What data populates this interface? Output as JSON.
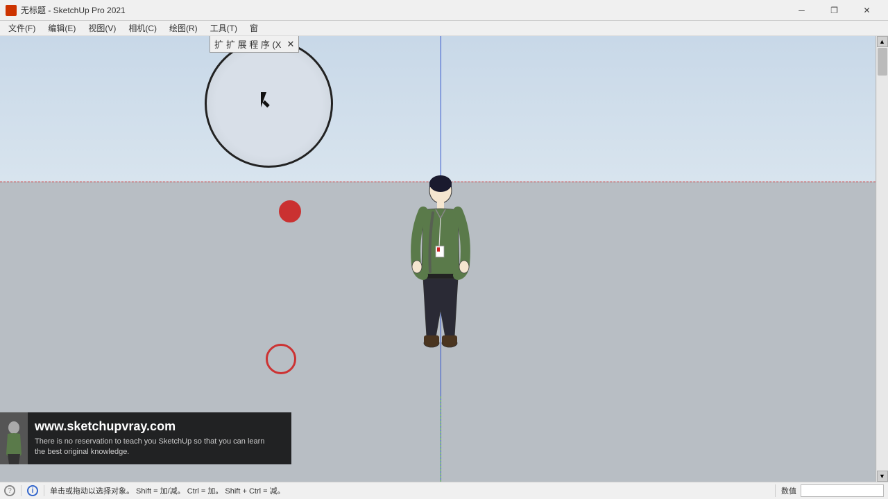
{
  "titlebar": {
    "title": "无标题 - SketchUp Pro 2021",
    "minimize": "─",
    "restore": "❐",
    "close": "✕"
  },
  "menubar": {
    "items": [
      {
        "label": "文件(F)"
      },
      {
        "label": "编辑(E)"
      },
      {
        "label": "视图(V)"
      },
      {
        "label": "相机(C)"
      },
      {
        "label": "绘图(R)"
      },
      {
        "label": "工具(T)"
      },
      {
        "label": "窗"
      }
    ]
  },
  "toolbar_popup": {
    "text": "扩 展 程 序 (X"
  },
  "statusbar": {
    "info_icon": "i",
    "question_icon": "?",
    "status_text": "单击或拖动以选择对象。 Shift = 加/减。 Ctrl = 加。 Shift + Ctrl = 减。",
    "right_label": "数值"
  },
  "watermark": {
    "url": "www.sketchupvray.com",
    "line1": "There is no reservation to teach you SketchUp so that you can learn",
    "line2": "the best original knowledge."
  }
}
